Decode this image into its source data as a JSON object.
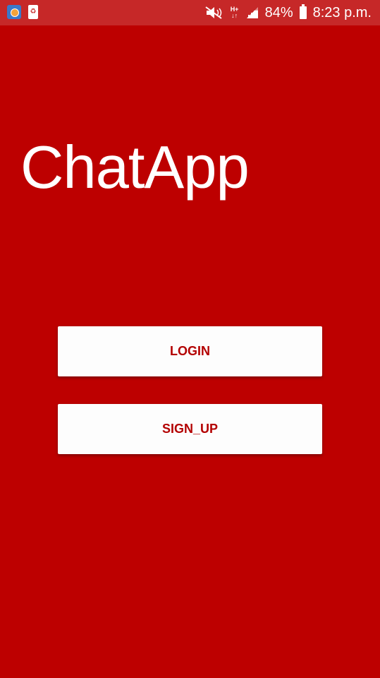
{
  "status_bar": {
    "notification_icons": [
      "app-notification-icon",
      "battery-saver-icon"
    ],
    "system_icons": [
      "mute-icon",
      "network-type-icon",
      "signal-icon",
      "battery-icon"
    ],
    "network_type": "H+",
    "battery_percent": "84%",
    "time": "8:23 p.m.",
    "background_color": "#c62828"
  },
  "main": {
    "app_title": "ChatApp",
    "background_color": "#bd0000",
    "login_button": "LOGIN",
    "signup_button": "SIGN_UP",
    "button_text_color": "#b30000",
    "button_background": "#fdfdfd"
  }
}
